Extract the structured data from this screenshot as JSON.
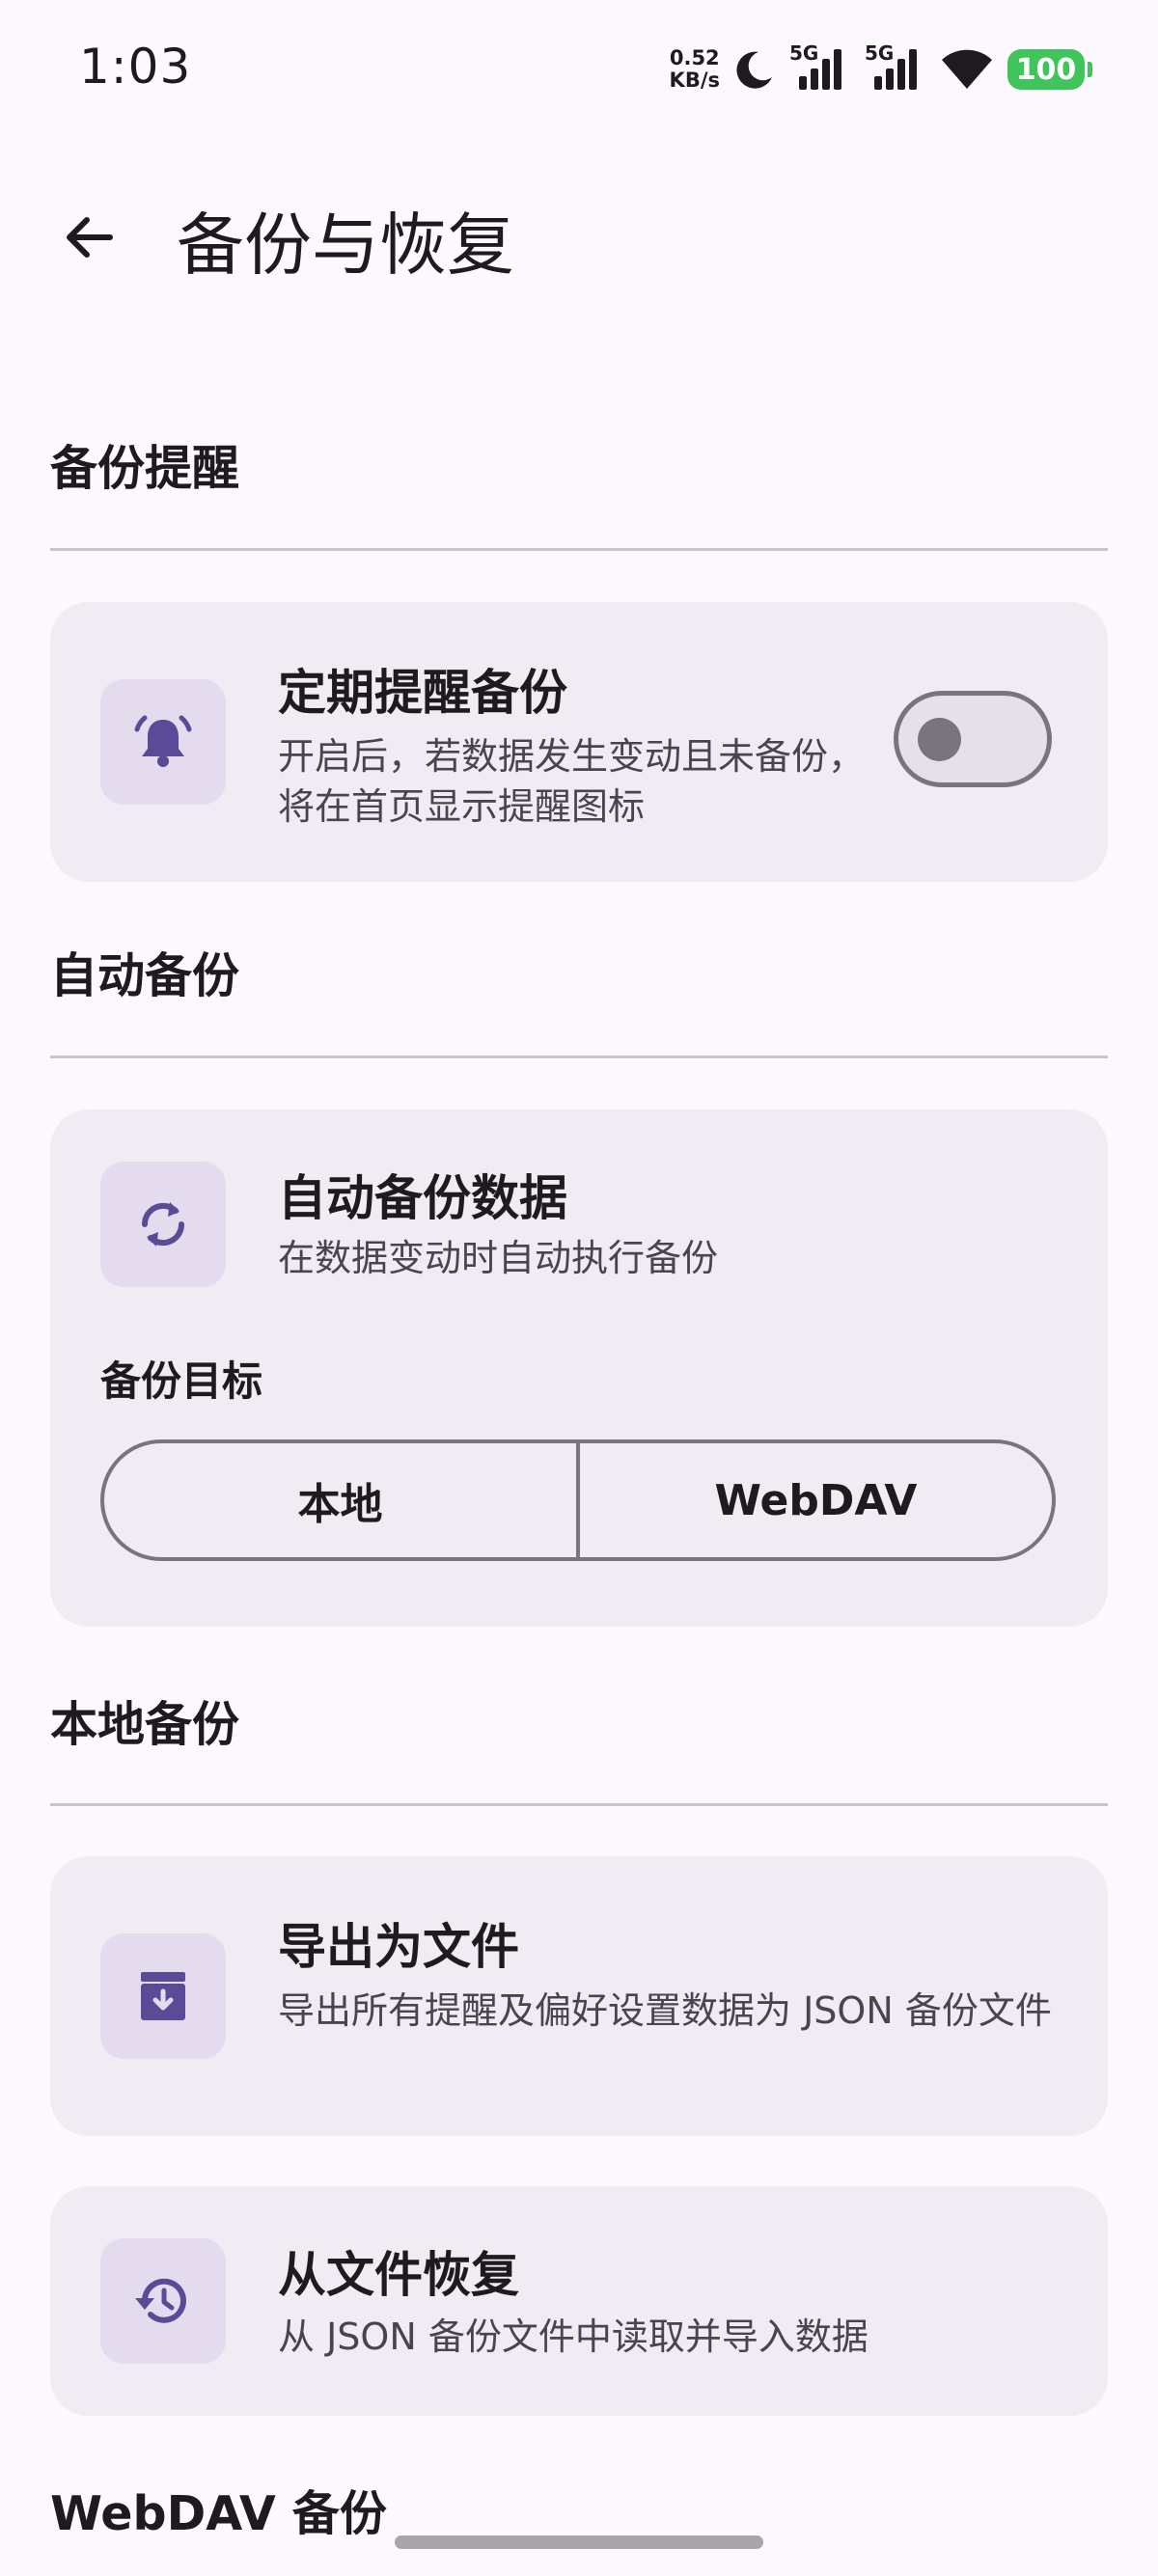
{
  "status_bar": {
    "time": "1:03",
    "net_speed_value": "0.52",
    "net_speed_unit": "KB/s",
    "signal1": "5G",
    "signal2": "5G",
    "battery": "100"
  },
  "app_bar": {
    "title": "备份与恢复"
  },
  "sections": {
    "reminder": {
      "title": "备份提醒"
    },
    "auto": {
      "title": "自动备份"
    },
    "local": {
      "title": "本地备份"
    },
    "webdav": {
      "title": "WebDAV 备份"
    }
  },
  "reminder_card": {
    "title": "定期提醒备份",
    "desc": "开启后，若数据发生变动且未备份，将在首页显示提醒图标",
    "toggle_on": false
  },
  "auto_card": {
    "title": "自动备份数据",
    "desc": "在数据变动时自动执行备份",
    "target_label": "备份目标",
    "targets": [
      "本地",
      "WebDAV"
    ]
  },
  "export_card": {
    "title": "导出为文件",
    "desc": "导出所有提醒及偏好设置数据为 JSON 备份文件"
  },
  "restore_card": {
    "title": "从文件恢复",
    "desc": "从 JSON 备份文件中读取并导入数据"
  },
  "colors": {
    "accent": "#6750a4",
    "card_bg": "#f1ecf4",
    "icon_bg": "#e4dcee",
    "background": "#fcf8fd",
    "battery": "#3fc55c"
  }
}
